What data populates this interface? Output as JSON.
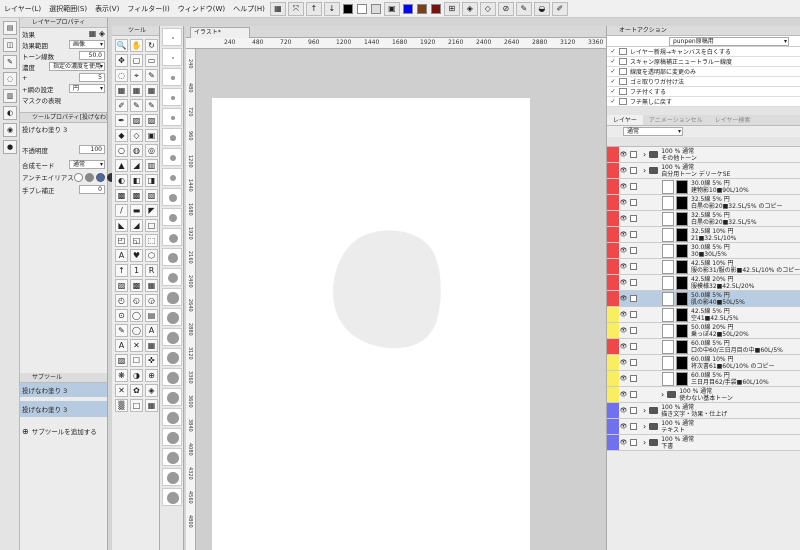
{
  "menubar": {
    "items": [
      "レイヤー(L)",
      "選択範囲(S)",
      "表示(V)",
      "フィルター(I)",
      "ウィンドウ(W)",
      "ヘルプ(H)"
    ],
    "swatch_colors": [
      "#000000",
      "#ffffff",
      "#ffffff",
      "#0000ff",
      "#7b3f1a",
      "#7b1010"
    ]
  },
  "left_panel": {
    "layer_prop_title": "レイヤープロパティ",
    "effect_label": "効果",
    "effect_range_label": "効果範囲",
    "effect_range_value": "画像",
    "tone_lines_label": "トーン線数",
    "tone_lines_value": "50.0",
    "density_label": "濃度",
    "density_value": "指定の濃度を使用",
    "plus_label": "+",
    "plus_value": "5",
    "shape_label": "+網の設定",
    "shape_value": "円",
    "mask_label": "マスクの表現",
    "tool_prop_title": "ツールプロパティ[投げなわ塗り 3]",
    "tool_name": "投げなわ塗り 3",
    "opacity_label": "不透明度",
    "opacity_value": "100",
    "blend_label": "合成モード",
    "blend_value": "通常",
    "aa_label": "アンチエイリアス",
    "stab_label": "手ブレ補正",
    "stab_value": "0",
    "subtool_title": "サブツール",
    "subtool_group": "投げなわ塗り 3",
    "subtool_item": "投げなわ塗り 3",
    "add_subtool": "サブツールを追加する"
  },
  "toolbox": {
    "title": "ツール"
  },
  "canvas": {
    "tab": "イラスト*",
    "hruler": [
      "240",
      "480",
      "720",
      "960",
      "1200",
      "1440",
      "1680",
      "1920",
      "2160",
      "2400",
      "2640",
      "2880",
      "3120",
      "3360"
    ],
    "vruler": [
      "240",
      "480",
      "720",
      "960",
      "1200",
      "1440",
      "1680",
      "1920",
      "2160",
      "2400",
      "2640",
      "2880",
      "3120",
      "3360",
      "3600",
      "3840",
      "4080",
      "4320",
      "4560",
      "4800"
    ]
  },
  "right_panel": {
    "auto_action_title": "オートアクション",
    "auto_action_set": "punpen原稿用",
    "auto_actions": [
      "レイヤー新規→キャンバスを白くする",
      "スキャン原稿補正ニュートラルー線度",
      "線度を透明部に変更のみ",
      "ゴミ取りワガ付け法",
      "フチ付くする",
      "フチ無しに戻す"
    ],
    "layer_tabs": [
      "レイヤー",
      "アニメーションセル",
      "レイヤー検索"
    ],
    "blend_mode": "通常",
    "layers": [
      {
        "c": "#f04848",
        "t": "folder",
        "d": 0,
        "l1": "100 % 通常",
        "l2": "その他トーン"
      },
      {
        "c": "#f04848",
        "t": "folder",
        "d": 0,
        "l1": "100 % 通常",
        "l2": "自分用トーン デリーケSE"
      },
      {
        "c": "#f04848",
        "t": "layer",
        "d": 1,
        "l1": "30.0線 5% 円",
        "l2": "建物影10■90L/10%"
      },
      {
        "c": "#f04848",
        "t": "layer",
        "d": 1,
        "l1": "32.5線 5% 円",
        "l2": "白黒の影20■32.5L/5% のコピー"
      },
      {
        "c": "#f04848",
        "t": "layer",
        "d": 1,
        "l1": "32.5線 5% 円",
        "l2": "白黒の影20■32.5L/5%"
      },
      {
        "c": "#f04848",
        "t": "layer",
        "d": 1,
        "l1": "32.5線 10% 円",
        "l2": "21■32.5L/10%"
      },
      {
        "c": "#f04848",
        "t": "layer",
        "d": 1,
        "l1": "30.0線 5% 円",
        "l2": "30■30L/5%"
      },
      {
        "c": "#f04848",
        "t": "layer",
        "d": 1,
        "l1": "42.5線 10% 円",
        "l2": "服の影31/服の影■42.5L/10% のコピー"
      },
      {
        "c": "#f04848",
        "t": "layer",
        "d": 1,
        "l1": "42.5線 20% 円",
        "l2": "服模様32■42.5L/20%"
      },
      {
        "c": "#f04848",
        "t": "layer",
        "d": 1,
        "l1": "50.0線 5% 円",
        "l2": "肌の影40■50L/5%",
        "active": true
      },
      {
        "c": "#f8ee60",
        "t": "layer",
        "d": 1,
        "l1": "42.5線 5% 円",
        "l2": "空41■42.5L/5%"
      },
      {
        "c": "#f8ee60",
        "t": "layer",
        "d": 1,
        "l1": "50.0線 20% 円",
        "l2": "乗っぽ42■50L/20%"
      },
      {
        "c": "#f04848",
        "t": "layer",
        "d": 1,
        "l1": "60.0線 5% 円",
        "l2": "口の中60/三日月目の中■60L/5%"
      },
      {
        "c": "#f8ee60",
        "t": "layer",
        "d": 1,
        "l1": "60.0線 10% 円",
        "l2": "将次書61■60L/10% のコピー"
      },
      {
        "c": "#f8ee60",
        "t": "layer",
        "d": 1,
        "l1": "60.0線 5% 円",
        "l2": "三日月目62/手袋■60L/10%"
      },
      {
        "c": "#f8ee60",
        "t": "folder",
        "d": 1,
        "l1": "100 % 通常",
        "l2": "使わない基本トーン"
      },
      {
        "c": "#7070f0",
        "t": "folder",
        "d": 0,
        "l1": "100 % 通常",
        "l2": "描き文字・効果・仕上げ"
      },
      {
        "c": "#7070f0",
        "t": "folder",
        "d": 0,
        "l1": "100 % 通常",
        "l2": "テキスト"
      },
      {
        "c": "#7070f0",
        "t": "folder",
        "d": 0,
        "l1": "100 % 通常",
        "l2": "下書"
      }
    ]
  }
}
